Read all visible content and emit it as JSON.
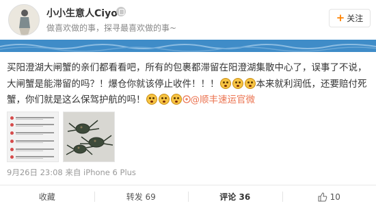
{
  "user": {
    "name": "小小生意人Ciyo",
    "bio": "做喜欢做的事，探寻最喜欢做的事~"
  },
  "follow": {
    "plus": "+",
    "label": "关注"
  },
  "post": {
    "text1": "买阳澄湖大闸蟹的亲们都看看吧，所有的包裹都滞留在阳澄湖集散中心了，误事了不说，大闸蟹是能滞留的吗？！爆仓你就该停止收件！！！",
    "text2": "本来就利润低，还要赔付死蟹，你们就是这么保驾护航的吗！",
    "mention": "@顺丰速运官微",
    "timestamp": "9月26日 23:08",
    "source": "来自 iPhone 6 Plus"
  },
  "actions": {
    "favorite": "收藏",
    "repost": "转发 69",
    "comment": "评论 36",
    "like": "10"
  },
  "colors": {
    "mention": "#eb7350",
    "banner": "#3f8cc8",
    "follow_plus": "#ff8200"
  }
}
